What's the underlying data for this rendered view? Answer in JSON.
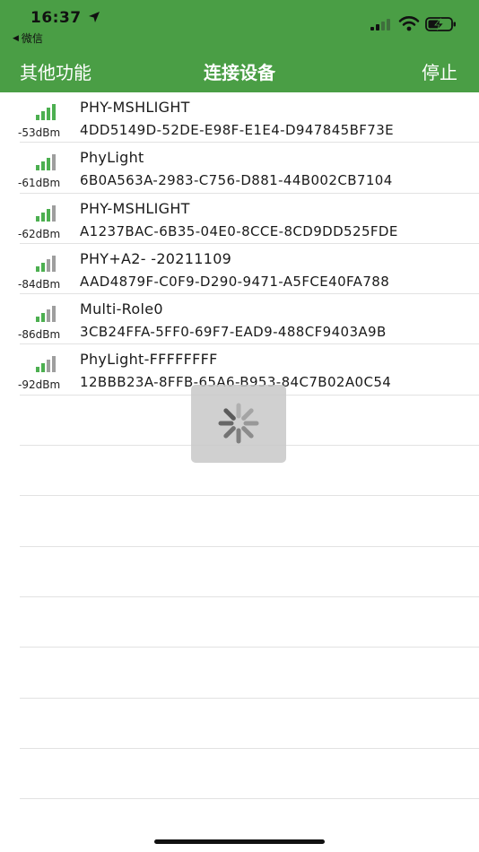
{
  "colors": {
    "brand": "#4a9e45",
    "signal_green": "#4caf50",
    "signal_gray": "#9e9e9e"
  },
  "status_bar": {
    "time": "16:37",
    "back_app": "微信",
    "icons": [
      "location-arrow-icon",
      "cellular-icon",
      "wifi-icon",
      "battery-charging-icon"
    ]
  },
  "nav": {
    "left": "其他功能",
    "title": "连接设备",
    "right": "停止"
  },
  "devices": [
    {
      "rssi": "-53dBm",
      "bars": 4,
      "name": "PHY-MSHLIGHT",
      "uuid": "4DD5149D-52DE-E98F-E1E4-D947845BF73E"
    },
    {
      "rssi": "-61dBm",
      "bars": 3,
      "name": "PhyLight",
      "uuid": "6B0A563A-2983-C756-D881-44B002CB7104"
    },
    {
      "rssi": "-62dBm",
      "bars": 3,
      "name": "PHY-MSHLIGHT",
      "uuid": "A1237BAC-6B35-04E0-8CCE-8CD9DD525FDE"
    },
    {
      "rssi": "-84dBm",
      "bars": 2,
      "name": "PHY+A2- -20211109",
      "uuid": "AAD4879F-C0F9-D290-9471-A5FCE40FA788"
    },
    {
      "rssi": "-86dBm",
      "bars": 2,
      "name": "Multi-Role0",
      "uuid": "3CB24FFA-5FF0-69F7-EAD9-488CF9403A9B"
    },
    {
      "rssi": "-92dBm",
      "bars": 2,
      "name": "PhyLight-FFFFFFFF",
      "uuid": "12BBB23A-8FFB-65A6-B953-84C7B02A0C54"
    }
  ],
  "loading": {
    "icon": "activity-spinner-icon",
    "visible": true
  }
}
